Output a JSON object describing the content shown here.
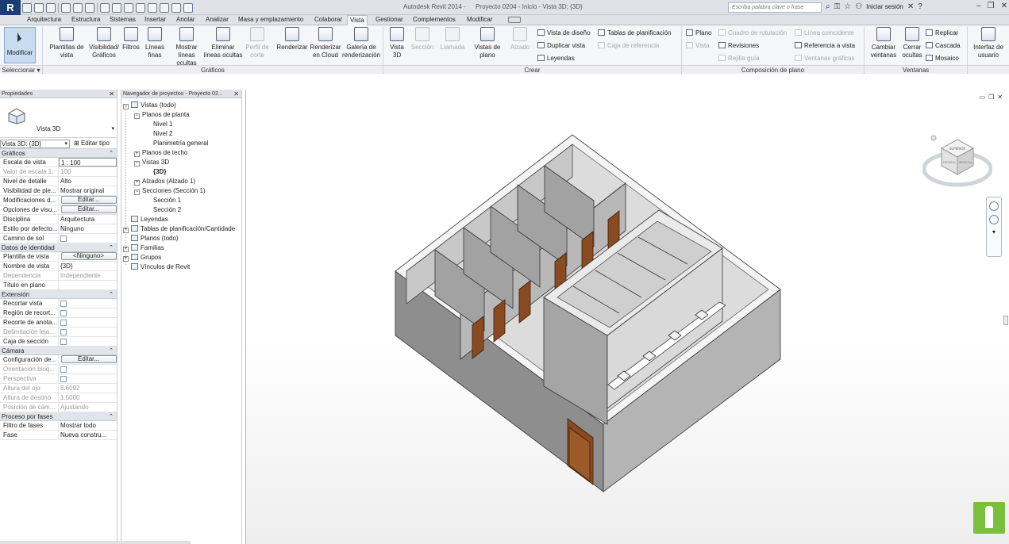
{
  "app": {
    "title_parts": [
      "Autodesk Revit 2014 -",
      "Proyecto 0204 - Inicio - Vista 3D: {3D}"
    ],
    "logo_letter": "R",
    "search_placeholder": "Escriba palabra clave o frase",
    "sign_in": "Iniciar sesión",
    "help": "?"
  },
  "tabs": [
    "Arquitectura",
    "Estructura",
    "Sistemas",
    "Insertar",
    "Anotar",
    "Analizar",
    "Masa y emplazamiento",
    "Colaborar",
    "Vista",
    "Gestionar",
    "Complementos",
    "Modificar"
  ],
  "active_tab": "Vista",
  "ribbon": {
    "modify": "Modificar",
    "select_panel": "Seleccionar",
    "graphics_panel": "Gráficos",
    "create_panel": "Crear",
    "sheet_panel": "Composición de plano",
    "windows_panel": "Ventanas",
    "graphics_buttons": [
      {
        "l1": "Plantillas de",
        "l2": "vista",
        "dis": false
      },
      {
        "l1": "Visibilidad/",
        "l2": "Gráficos",
        "dis": false
      },
      {
        "l1": "Filtros",
        "l2": "",
        "dis": false
      },
      {
        "l1": "Líneas",
        "l2": "finas",
        "dis": false
      },
      {
        "l1": "Mostrar",
        "l2": "líneas ocultas",
        "dis": false
      },
      {
        "l1": "Eliminar",
        "l2": "líneas ocultas",
        "dis": false
      },
      {
        "l1": "Perfil de",
        "l2": "corte",
        "dis": true
      },
      {
        "l1": "Renderizar",
        "l2": "",
        "dis": false
      },
      {
        "l1": "Renderizar",
        "l2": "en Cloud",
        "dis": false
      },
      {
        "l1": "Galería de",
        "l2": "renderización",
        "dis": false
      }
    ],
    "create_buttons": [
      {
        "l1": "Vista",
        "l2": "3D",
        "dis": false
      },
      {
        "l1": "Sección",
        "l2": "",
        "dis": true
      },
      {
        "l1": "Llamada",
        "l2": "",
        "dis": true
      },
      {
        "l1": "Vistas de",
        "l2": "plano",
        "dis": false
      },
      {
        "l1": "Alzado",
        "l2": "",
        "dis": true
      }
    ],
    "create_small": [
      {
        "t": "Vista de diseño",
        "dis": false
      },
      {
        "t": "Duplicar vista",
        "dis": false
      },
      {
        "t": "Leyendas",
        "dis": false
      },
      {
        "t": "Tablas de planificación",
        "dis": false
      },
      {
        "t": "Caja de referencia",
        "dis": true
      }
    ],
    "sheet_small": [
      {
        "t": "Plano",
        "dis": false
      },
      {
        "t": "Vista",
        "dis": true
      },
      {
        "t": "Cuadro de rotulación",
        "dis": true
      },
      {
        "t": "Revisiones",
        "dis": false
      },
      {
        "t": "Rejilla guía",
        "dis": true
      },
      {
        "t": "Línea coincidente",
        "dis": true
      },
      {
        "t": "Referencia a vista",
        "dis": false
      },
      {
        "t": "Ventanas gráficas",
        "dis": true
      }
    ],
    "window_buttons": [
      {
        "l1": "Cambiar",
        "l2": "ventanas"
      },
      {
        "l1": "Cerrar",
        "l2": "ocultas"
      }
    ],
    "window_small": [
      "Replicar",
      "Cascada",
      "Mosaico"
    ],
    "ui_button": {
      "l1": "Interfaz de",
      "l2": "usuario"
    }
  },
  "properties": {
    "title": "Propiedades",
    "type_name": "Vista 3D",
    "selector": "Vista 3D: {3D}",
    "edit_type": "Editar tipo",
    "groups": [
      {
        "name": "Gráficos",
        "rows": [
          {
            "k": "Escala de vista",
            "v": "1 : 100",
            "kind": "box"
          },
          {
            "k": "Valor de escala   1:",
            "v": "100",
            "kind": "dis"
          },
          {
            "k": "Nivel de detalle",
            "v": "Alto",
            "kind": "text"
          },
          {
            "k": "Visibilidad de pie...",
            "v": "Mostrar original",
            "kind": "text"
          },
          {
            "k": "Modificaciones d...",
            "v": "Editar...",
            "kind": "btn"
          },
          {
            "k": "Opciones de visu...",
            "v": "Editar...",
            "kind": "btn"
          },
          {
            "k": "Disciplina",
            "v": "Arquitectura",
            "kind": "text"
          },
          {
            "k": "Estilo por defecto...",
            "v": "Ninguno",
            "kind": "text"
          },
          {
            "k": "Camino de sol",
            "v": "",
            "kind": "chk"
          }
        ]
      },
      {
        "name": "Datos de identidad",
        "rows": [
          {
            "k": "Plantilla de vista",
            "v": "<Ninguno>",
            "kind": "btn"
          },
          {
            "k": "Nombre de vista",
            "v": "{3D}",
            "kind": "text"
          },
          {
            "k": "Dependencia",
            "v": "Independiente",
            "kind": "dis"
          },
          {
            "k": "Título en plano",
            "v": "",
            "kind": "text"
          }
        ]
      },
      {
        "name": "Extensión",
        "rows": [
          {
            "k": "Recortar vista",
            "v": "",
            "kind": "chk"
          },
          {
            "k": "Región de recort...",
            "v": "",
            "kind": "chk"
          },
          {
            "k": "Recorte de anota...",
            "v": "",
            "kind": "chk"
          },
          {
            "k": "Delimitación leja...",
            "v": "",
            "kind": "chkdis"
          },
          {
            "k": "Caja de sección",
            "v": "",
            "kind": "chk"
          }
        ]
      },
      {
        "name": "Cámara",
        "rows": [
          {
            "k": "Configuración de...",
            "v": "Editar...",
            "kind": "btn"
          },
          {
            "k": "Orientación bloq...",
            "v": "",
            "kind": "chkdis"
          },
          {
            "k": "Perspectiva",
            "v": "",
            "kind": "chkdis"
          },
          {
            "k": "Altura del ojo",
            "v": "8.6092",
            "kind": "dis"
          },
          {
            "k": "Altura de destino",
            "v": "1.5000",
            "kind": "dis"
          },
          {
            "k": "Posición de cám...",
            "v": "Ajustando",
            "kind": "dis"
          }
        ]
      },
      {
        "name": "Proceso por fases",
        "rows": [
          {
            "k": "Filtro de fases",
            "v": "Mostrar todo",
            "kind": "text"
          },
          {
            "k": "Fase",
            "v": "Nueva constru...",
            "kind": "text"
          }
        ]
      }
    ]
  },
  "browser": {
    "title": "Navegador de proyectos - Proyecto 02...",
    "nodes": [
      {
        "t": "Vistas (todo)",
        "lvl": 0,
        "tg": "−",
        "icon": true,
        "bold": false
      },
      {
        "t": "Planos de planta",
        "lvl": 1,
        "tg": "−",
        "icon": false,
        "bold": false
      },
      {
        "t": "Nivel 1",
        "lvl": 2,
        "tg": "",
        "icon": false,
        "bold": false
      },
      {
        "t": "Nivel 2",
        "lvl": 2,
        "tg": "",
        "icon": false,
        "bold": false
      },
      {
        "t": "Planimetría general",
        "lvl": 2,
        "tg": "",
        "icon": false,
        "bold": false
      },
      {
        "t": "Planos de techo",
        "lvl": 1,
        "tg": "+",
        "icon": false,
        "bold": false
      },
      {
        "t": "Vistas 3D",
        "lvl": 1,
        "tg": "−",
        "icon": false,
        "bold": false
      },
      {
        "t": "{3D}",
        "lvl": 2,
        "tg": "",
        "icon": false,
        "bold": true
      },
      {
        "t": "Alzados (Alzado 1)",
        "lvl": 1,
        "tg": "+",
        "icon": false,
        "bold": false
      },
      {
        "t": "Secciones (Sección  1)",
        "lvl": 1,
        "tg": "−",
        "icon": false,
        "bold": false
      },
      {
        "t": "Sección 1",
        "lvl": 2,
        "tg": "",
        "icon": false,
        "bold": false
      },
      {
        "t": "Sección 2",
        "lvl": 2,
        "tg": "",
        "icon": false,
        "bold": false
      },
      {
        "t": "Leyendas",
        "lvl": 0,
        "tg": "",
        "icon": true,
        "bold": false
      },
      {
        "t": "Tablas de planificación/Cantidade",
        "lvl": 0,
        "tg": "+",
        "icon": true,
        "bold": false
      },
      {
        "t": "Planos (todo)",
        "lvl": 0,
        "tg": "",
        "icon": true,
        "bold": false
      },
      {
        "t": "Familias",
        "lvl": 0,
        "tg": "+",
        "icon": true,
        "bold": false
      },
      {
        "t": "Grupos",
        "lvl": 0,
        "tg": "+",
        "icon": true,
        "bold": false
      },
      {
        "t": "Vínculos de Revit",
        "lvl": 0,
        "tg": "",
        "icon": true,
        "bold": false
      }
    ]
  },
  "viewcube": {
    "face_top": "SUPERIOR",
    "face_front": "FRONTAL",
    "face_right": "DERECHA"
  },
  "colors": {
    "door": "#8a4a22",
    "wall_left": "#8c8c8c",
    "wall_right": "#b4b4b4",
    "top": "#f2f2f2",
    "accent_green": "#7bbf3f",
    "select_blue": "#c8dcf0"
  }
}
